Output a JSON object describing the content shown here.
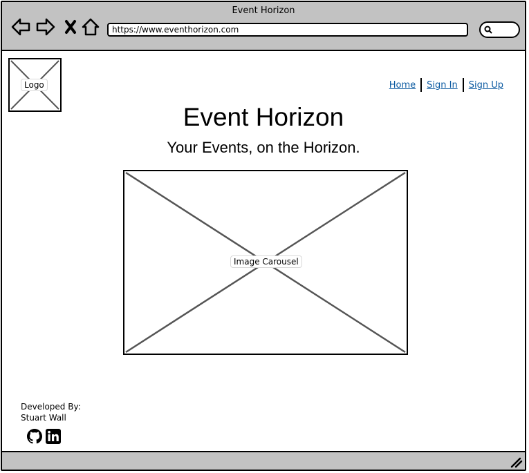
{
  "window": {
    "title": "Event Horizon"
  },
  "browser": {
    "url": "https://www.eventhorizon.com",
    "icons": [
      "back-arrow-icon",
      "forward-arrow-icon",
      "close-x-icon",
      "home-icon",
      "search-icon"
    ]
  },
  "logo": {
    "label": "Logo"
  },
  "nav": {
    "home": "Home",
    "sign_in": "Sign In",
    "sign_up": "Sign Up"
  },
  "hero": {
    "title": "Event Horizon",
    "subtitle": "Your Events, on the Horizon."
  },
  "carousel": {
    "label": "Image Carousel"
  },
  "footer": {
    "developed_by": "Developed By:",
    "developer": "Stuart Wall",
    "social_icons": [
      "github-icon",
      "linkedin-icon"
    ]
  },
  "colors": {
    "chrome": "#c2c2c2",
    "link": "#0b5aa1",
    "placeholder_line": "#555555"
  }
}
